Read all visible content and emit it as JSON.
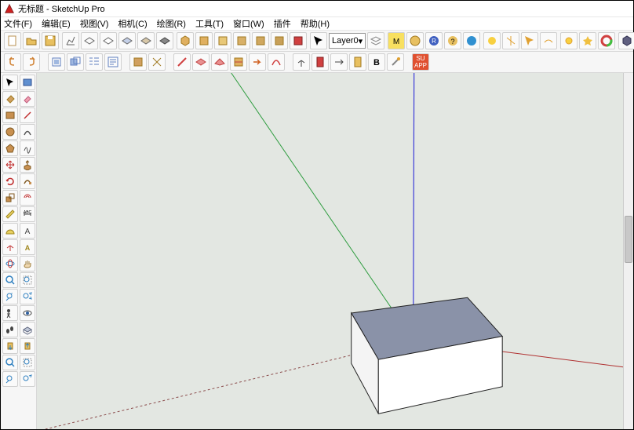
{
  "window": {
    "title": "无标题 - SketchUp Pro"
  },
  "menu": {
    "file": "文件(F)",
    "edit": "编辑(E)",
    "view": "视图(V)",
    "camera": "相机(C)",
    "draw": "绘图(R)",
    "tools": "工具(T)",
    "window": "窗口(W)",
    "plugins": "插件",
    "help": "帮助(H)"
  },
  "layer": {
    "current": "Layer0"
  },
  "viewport": {
    "axes": {
      "x_color": "#b03030",
      "y_color": "#2d9c3e",
      "z_color": "#3a3ad8"
    },
    "object": {
      "type": "box",
      "top_color": "#8a92a8",
      "side_color": "#f4f4f4",
      "edge_color": "#202020"
    },
    "bg": "#e3e7e2"
  }
}
